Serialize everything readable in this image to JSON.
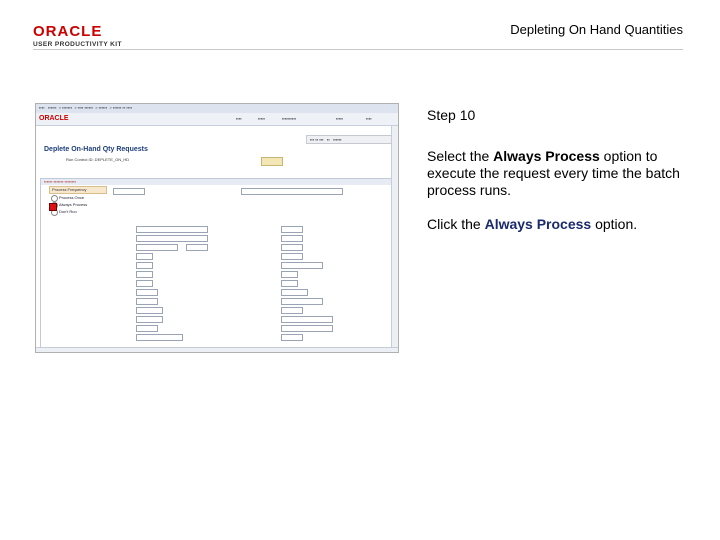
{
  "header": {
    "logo_line1": "ORACLE",
    "logo_line2": "USER PRODUCTIVITY KIT",
    "title": "Depleting On Hand Quantities"
  },
  "instructions": {
    "step": "Step 10",
    "p1_a": "Select the ",
    "p1_b": "Always Process",
    "p1_c": " option to execute the request every time the batch process runs.",
    "p2_a": "Click the ",
    "p2_b": "Always Process",
    "p2_c": " option."
  },
  "screenshot": {
    "page_title": "Deplete On-Hand Qty Requests",
    "run_control_label": "Run Control ID: DEPLETE_ON_HD",
    "process_frequency_label": "Process Frequency",
    "radio_options": [
      "Process Once",
      "Always Process",
      "Don't Run"
    ]
  },
  "colors": {
    "oracle_red": "#cc0000",
    "highlight_text": "#1a2a6c",
    "marker": "#dd1111"
  }
}
